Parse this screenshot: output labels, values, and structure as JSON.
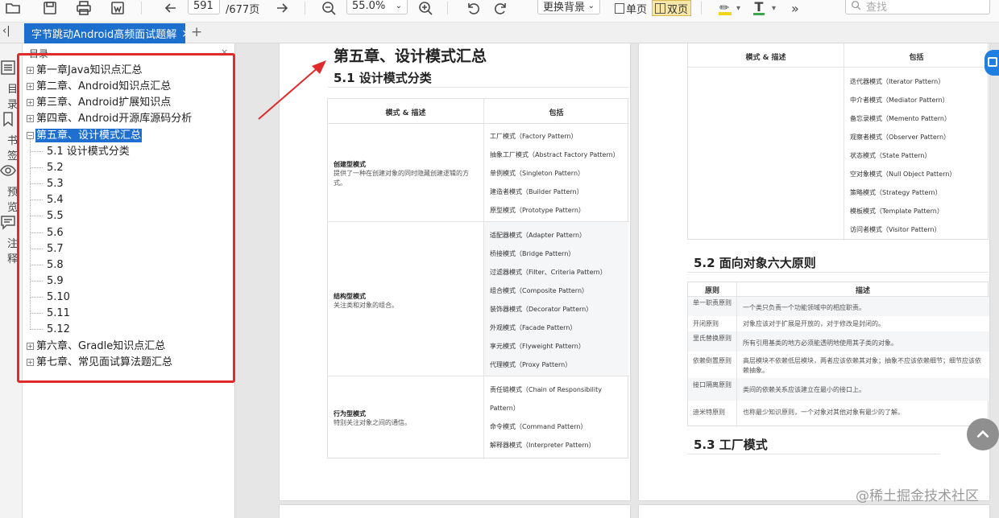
{
  "toolbar": {
    "page_current": "591",
    "page_total": "/677页",
    "zoom": "55.0%",
    "bg_button": "更换背景",
    "single_page": "单页",
    "double_page": "双页",
    "search_placeholder": "查找",
    "icons": [
      "open-folder-icon",
      "save-icon",
      "print-icon",
      "export-word-icon",
      "arrow-left-icon",
      "arrow-right-icon",
      "zoom-out-icon",
      "zoom-in-icon",
      "rotate-left-icon",
      "rotate-right-icon",
      "highlight-icon",
      "text-color-icon",
      "more-icon",
      "search-icon"
    ]
  },
  "tab": {
    "title": "字节跳动Android高频面试题解",
    "close": "×",
    "add": "+",
    "collapse": "‹|"
  },
  "rail": {
    "items": [
      {
        "label": "目录",
        "icon": "toc-icon"
      },
      {
        "label": "书签",
        "icon": "bookmark-icon"
      },
      {
        "label": "预览",
        "icon": "eye-icon"
      },
      {
        "label": "注释",
        "icon": "comment-icon"
      }
    ]
  },
  "toc": {
    "header": "目录",
    "items": [
      {
        "label": "第一章Java知识点汇总",
        "toggle": "+"
      },
      {
        "label": "第二章、Android知识点汇总",
        "toggle": "+"
      },
      {
        "label": "第三章、Android扩展知识点",
        "toggle": "+"
      },
      {
        "label": "第四章、Android开源库源码分析",
        "toggle": "+"
      },
      {
        "label": "第五章、设计模式汇总",
        "toggle": "−"
      },
      {
        "label": "5.1 设计模式分类"
      },
      {
        "label": "5.2"
      },
      {
        "label": "5.3"
      },
      {
        "label": "5.4"
      },
      {
        "label": "5.5"
      },
      {
        "label": "5.6"
      },
      {
        "label": "5.7"
      },
      {
        "label": "5.8"
      },
      {
        "label": "5.9"
      },
      {
        "label": "5.10"
      },
      {
        "label": "5.11"
      },
      {
        "label": "5.12"
      },
      {
        "label": "第六章、Gradle知识点汇总",
        "toggle": "+"
      },
      {
        "label": "第七章、常见面试算法题汇总",
        "toggle": "+"
      }
    ]
  },
  "left_page": {
    "chapter": "第五章、设计模式汇总",
    "section": "5.1 设计模式分类",
    "table_headers": [
      "模式 & 描述",
      "包括"
    ],
    "groups": [
      {
        "title": "创建型模式",
        "desc": "提供了一种在创建对象的同时隐藏创建逻辑的方式。",
        "items": [
          "工厂模式（Factory Pattern）",
          "抽象工厂模式（Abstract Factory Pattern）",
          "单例模式（Singleton Pattern）",
          "建造者模式（Builder Pattern）",
          "原型模式（Prototype Pattern）"
        ]
      },
      {
        "title": "结构型模式",
        "desc": "关注类和对象的组合。",
        "items": [
          "适配器模式（Adapter Pattern）",
          "桥接模式（Bridge Pattern）",
          "过滤器模式（Filter、Criteria Pattern）",
          "组合模式（Composite Pattern）",
          "装饰器模式（Decorator Pattern）",
          "外观模式（Facade Pattern）",
          "享元模式（Flyweight Pattern）",
          "代理模式（Proxy Pattern）"
        ]
      },
      {
        "title": "行为型模式",
        "desc": "特别关注对象之间的通信。",
        "items": [
          "责任链模式（Chain of Responsibility",
          "Pattern）",
          "命令模式（Command Pattern）",
          "解释器模式（Interpreter Pattern）"
        ]
      }
    ]
  },
  "right_page": {
    "table_headers": [
      "模式 & 描述",
      "包括"
    ],
    "items": [
      "迭代器模式（Iterator Pattern）",
      "中介者模式（Mediator Pattern）",
      "备忘录模式（Memento Pattern）",
      "观察者模式（Observer Pattern）",
      "状态模式（State Pattern）",
      "空对象模式（Null Object Pattern）",
      "策略模式（Strategy Pattern）",
      "模板模式（Template Pattern）",
      "访问者模式（Visitor Pattern）"
    ],
    "section2": "5.2 面向对象六大原则",
    "principles_headers": [
      "原则",
      "描述"
    ],
    "principles": [
      {
        "name": "单一职责原则",
        "desc": "一个类只负责一个功能领域中的相应职责。"
      },
      {
        "name": "开闭原则",
        "desc": "对象应该对于扩展是开放的，对于修改是封闭的。"
      },
      {
        "name": "里氏替换原则",
        "desc": "所有引用基类的地方必须能透明地使用其子类的对象。"
      },
      {
        "name": "依赖倒置原则",
        "desc": "高层模块不依赖低层模块，两者应该依赖其对象；抽象不应该依赖细节；细节应该依赖抽象。"
      },
      {
        "name": "接口隔离原则",
        "desc": "类间的依赖关系应该建立在最小的接口上。"
      },
      {
        "name": "迪米特原则",
        "desc": "也称最少知识原则，一个对象对其他对象有最少的了解。"
      }
    ],
    "section3": "5.3 工厂模式"
  },
  "watermark": "@稀土掘金技术社区",
  "colors": {
    "accent": "#1e6fd0",
    "annotation_red": "#e12a2a"
  }
}
